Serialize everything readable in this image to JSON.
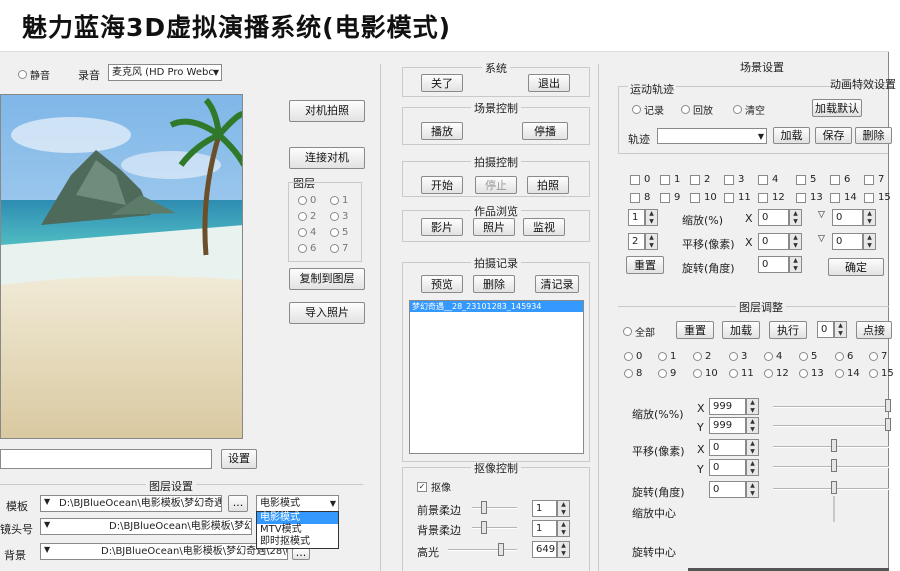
{
  "title": "魅力蓝海3D虚拟演播系统(电影模式)",
  "audio": {
    "mute": "静音",
    "record": "录音",
    "device": "麦克风 (HD Pro Webc"
  },
  "left": {
    "btn_shoot": "对机拍照",
    "btn_connect": "连接对机",
    "layers_label": "图层",
    "layers": [
      "0",
      "1",
      "2",
      "3",
      "4",
      "5",
      "6",
      "7"
    ],
    "btn_copy_layer": "复制到图层",
    "btn_import": "导入照片",
    "path_value": "",
    "btn_set": "设置"
  },
  "layer_settings": {
    "title": "图层设置",
    "rows": [
      {
        "label": "模板",
        "path": "D:\\BJBlueOcean\\电影模板\\梦幻奇遇"
      },
      {
        "label": "镜头号",
        "path": "D:\\BJBlueOcean\\电影模板\\梦幻奇"
      },
      {
        "label": "背景",
        "path": "D:\\BJBlueOcean\\电影模板\\梦幻奇遇\\28\\0"
      }
    ],
    "mode_value": "电影模式",
    "mode_options": [
      "电影模式",
      "MTV模式",
      "即时抠模式"
    ]
  },
  "system": {
    "title": "系统",
    "close": "关了",
    "exit": "退出"
  },
  "scene_ctrl": {
    "title": "场景控制",
    "play": "播放",
    "stop": "停播"
  },
  "shoot_ctrl": {
    "title": "拍摄控制",
    "start": "开始",
    "stop": "停止",
    "photo": "拍照"
  },
  "work_view": {
    "title": "作品浏览",
    "movie": "影片",
    "photo": "照片",
    "monitor": "监视"
  },
  "shoot_record": {
    "title": "拍摄记录",
    "preview": "预览",
    "delete": "删除",
    "clear": "清记录",
    "items": [
      "梦幻奇遇__28_23101283_145934"
    ]
  },
  "key_ctrl": {
    "title": "抠像控制",
    "key_label": "抠像",
    "key_checked": true,
    "rows": [
      {
        "label": "前景柔边",
        "value": "1"
      },
      {
        "label": "背景柔边",
        "value": "1"
      },
      {
        "label": "高光",
        "value": "649"
      }
    ]
  },
  "scene_settings": {
    "title": "场景设置",
    "anim_label": "动画特效设置",
    "motion_label": "运动轨迹",
    "record": "记录",
    "replay": "回放",
    "clear": "清空",
    "load_default": "加载默认",
    "trail_label": "轨迹",
    "trail_value": "",
    "load": "加载",
    "save": "保存",
    "delete": "删除",
    "layers_row1": [
      "0",
      "1",
      "2",
      "3",
      "4",
      "5",
      "6",
      "7"
    ],
    "layers_row2": [
      "8",
      "9",
      "10",
      "11",
      "12",
      "13",
      "14",
      "15"
    ],
    "spin1": "1",
    "spin2": "2",
    "zoom_label": "缩放(%)",
    "pan_label": "平移(像素)",
    "rot_label": "旋转(角度)",
    "x": "X",
    "y": "Y",
    "zoom_x": "0",
    "zoom_y": "0",
    "pan_x": "0",
    "pan_y": "0",
    "rot": "0",
    "btn_reset": "重置",
    "btn_ok": "确定"
  },
  "layer_adjust": {
    "title": "图层调整",
    "all": "全部",
    "reset": "重置",
    "add": "加载",
    "exec": "执行",
    "spin_val": "0",
    "btn_right": "点接",
    "layers_row1": [
      "0",
      "1",
      "2",
      "3",
      "4",
      "5",
      "6",
      "7"
    ],
    "layers_row2": [
      "8",
      "9",
      "10",
      "11",
      "12",
      "13",
      "14",
      "15"
    ],
    "zoom_label": "缩放(%%)",
    "pan_label": "平移(像素)",
    "rot_label": "旋转(角度)",
    "x": "X",
    "y": "Y",
    "zoom_x": "999",
    "zoom_y": "999",
    "pan_x": "0",
    "pan_y": "0",
    "rot": "0",
    "zoom_center": "缩放中心",
    "rot_center": "旋转中心"
  }
}
